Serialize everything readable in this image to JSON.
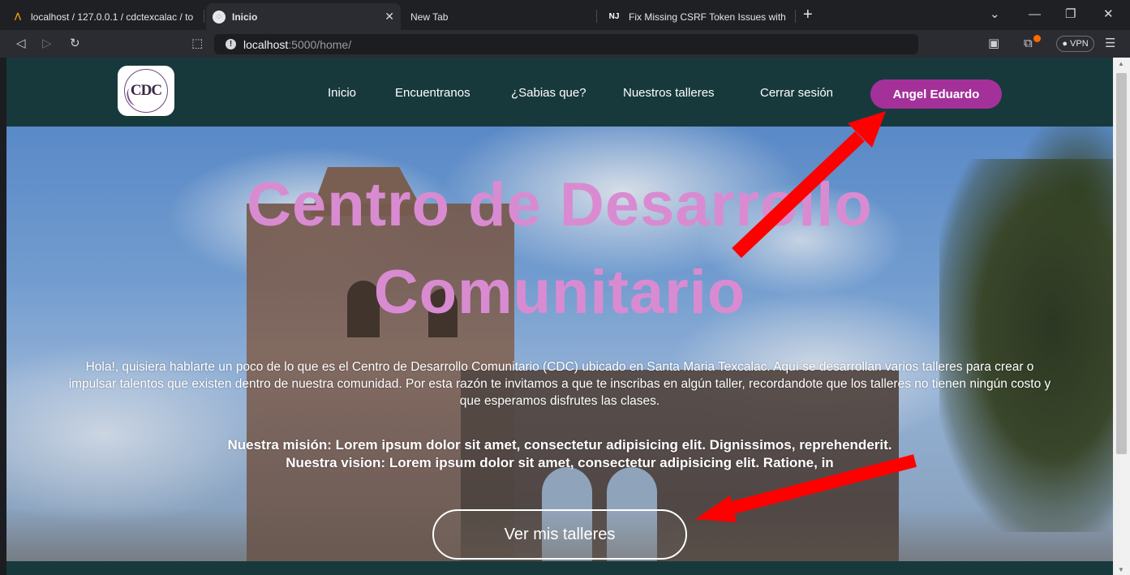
{
  "browser": {
    "tabs": [
      {
        "title": "localhost / 127.0.0.1 / cdctexcalac / to",
        "favicon": "phpmyadmin-icon"
      },
      {
        "title": "Inicio",
        "favicon": "site-favicon",
        "active": true
      },
      {
        "title": "New Tab",
        "favicon": ""
      },
      {
        "title": "Fix Missing CSRF Token Issues with Fla",
        "favicon": "NJ"
      }
    ],
    "close_glyph": "✕",
    "new_tab_glyph": "+",
    "url_host": "localhost",
    "url_rest": ":5000/home/",
    "vpn_label": "● VPN",
    "window_controls": [
      "⌄",
      "—",
      "❐",
      "✕"
    ]
  },
  "nav": {
    "links": [
      "Inicio",
      "Encuentranos",
      "¿Sabias que?",
      "Nuestros talleres",
      "Cerrar sesión"
    ],
    "user": "Angel Eduardo",
    "logo_text": "CDC"
  },
  "hero": {
    "title_line1": "Centro de Desarrollo",
    "title_line2": "Comunitario",
    "paragraph": "Hola!, quisiera hablarte un poco de lo que es el Centro de Desarrollo Comunitario (CDC) ubicado en Santa Maria Texcalac. Aquí se desarrollan varios talleres para crear o impulsar talentos que existen dentro de nuestra comunidad. Por esta razón te invitamos a que te inscribas en algún taller, recordandote que los talleres no tienen ningún costo y que esperamos disfrutes las clases.",
    "mission": "Nuestra misión: Lorem ipsum dolor sit amet, consectetur adipisicing elit. Dignissimos, reprehenderit.",
    "vision": "Nuestra vision: Lorem ipsum dolor sit amet, consectetur adipisicing elit. Ratione, in",
    "button": "Ver mis talleres"
  },
  "colors": {
    "navbar": "#17393c",
    "accent": "#a4319a",
    "title": "#d98bd1",
    "annotation_arrow": "#ff0000"
  }
}
